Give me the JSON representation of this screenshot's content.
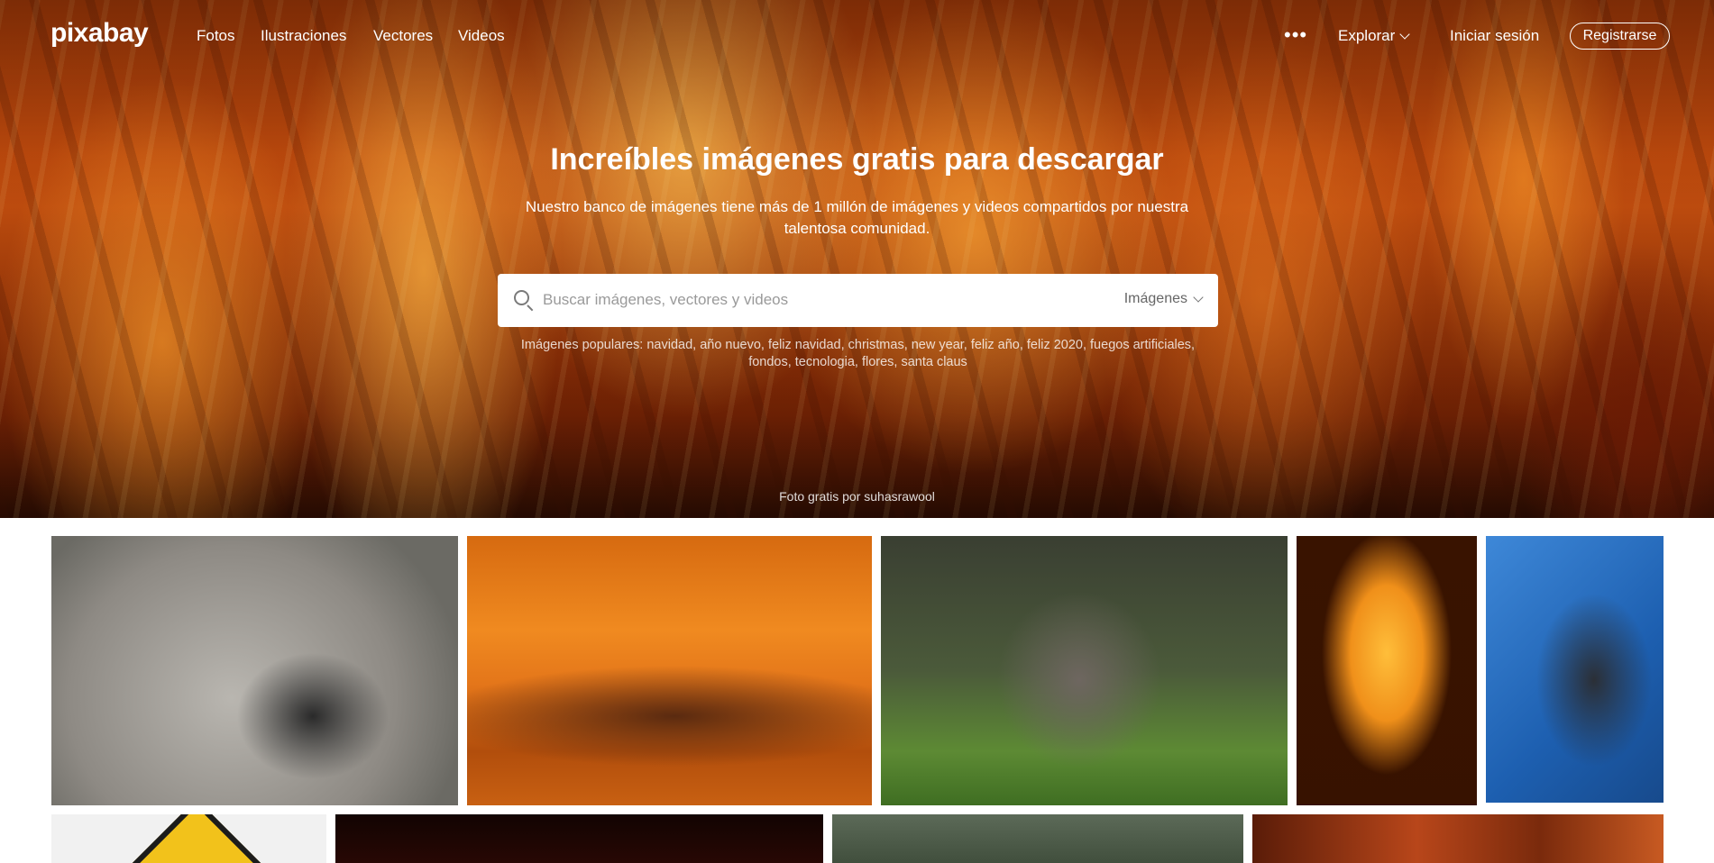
{
  "nav": {
    "logo": "pixabay",
    "links": [
      "Fotos",
      "Ilustraciones",
      "Vectores",
      "Videos"
    ],
    "more_icon": "ellipsis-icon",
    "explore_label": "Explorar",
    "login_label": "Iniciar sesión",
    "register_label": "Registrarse"
  },
  "hero": {
    "title": "Increíbles imágenes gratis para descargar",
    "subtitle": "Nuestro banco de imágenes tiene más de 1 millón de imágenes y videos compartidos por nuestra talentosa comunidad.",
    "search": {
      "placeholder": "Buscar imágenes, vectores y videos",
      "value": "",
      "type_label": "Imágenes"
    },
    "popular": "Imágenes populares: navidad, año nuevo, feliz navidad, christmas, new year, feliz año, feliz 2020, fuegos artificiales, fondos, tecnologia, flores, santa claus",
    "credit": "Foto gratis por suhasrawool"
  }
}
